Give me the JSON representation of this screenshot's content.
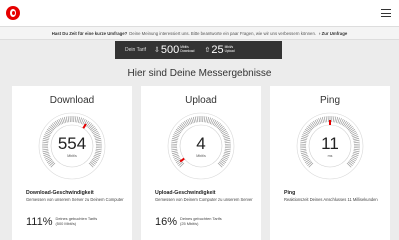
{
  "header": {
    "logo": "vodafone-logo",
    "menu_icon": "hamburger-menu-icon"
  },
  "survey": {
    "bold": "Hast Du Zeit für eine kurze Umfrage?",
    "text": "Deine Meinung interessiert uns. Bitte beantworte ein paar Fragen, wie wir uns verbessern können.",
    "link": "Zur Umfrage"
  },
  "tarif": {
    "label": "Dein Tarif",
    "download_value": "500",
    "download_unit": "Mbit/s",
    "download_label": "Download",
    "upload_value": "25",
    "upload_unit": "Mbit/s",
    "upload_label": "Upload"
  },
  "results_title": "Hier sind Deine Messergebnisse",
  "cards": [
    {
      "title": "Download",
      "value": "554",
      "unit": "Mbit/s",
      "label": "Download-Geschwindigkeit",
      "desc": "Gemessen von unserem Server zu Deinem Computer",
      "pct": "111%",
      "pct_desc_1": "Deines gebuchten Tarifs",
      "pct_desc_2": "(500 Mbit/s)",
      "needle_fraction": 0.62
    },
    {
      "title": "Upload",
      "value": "4",
      "unit": "Mbit/s",
      "label": "Upload-Geschwindigkeit",
      "desc": "Gemessen von Deinem Computer zu unserem Server",
      "pct": "16%",
      "pct_desc_1": "Deines gebuchten Tarifs",
      "pct_desc_2": "(25 Mbit/s)",
      "needle_fraction": 0.03
    },
    {
      "title": "Ping",
      "value": "11",
      "unit": "ms",
      "label": "Ping",
      "desc": "Reaktionszeit Deines Anschlusses 11 Millisekunden",
      "pct": "",
      "pct_desc_1": "",
      "pct_desc_2": "",
      "needle_fraction": 0.5
    }
  ],
  "colors": {
    "accent": "#e60000",
    "dark_bar": "#333333",
    "background": "#ececec"
  }
}
